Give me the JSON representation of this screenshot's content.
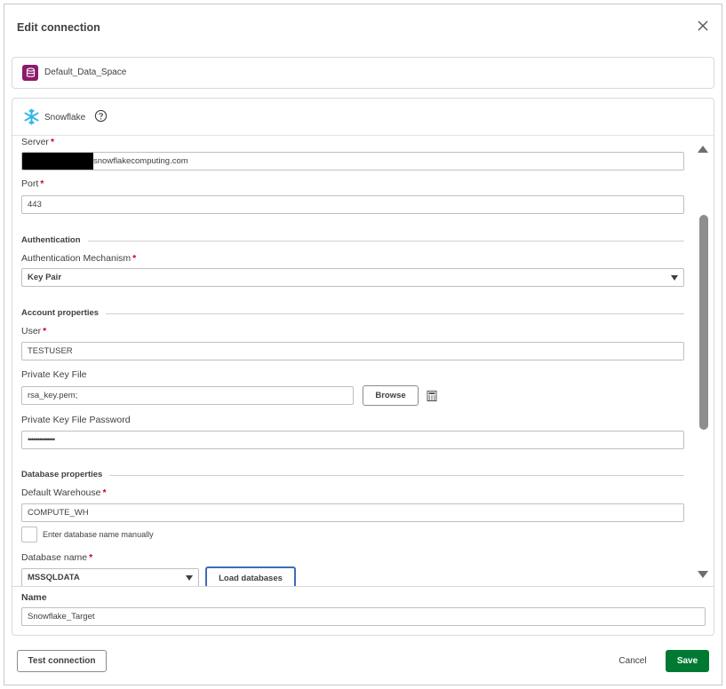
{
  "dialog": {
    "title": "Edit connection"
  },
  "space": {
    "name": "Default_Data_Space"
  },
  "connector": {
    "name": "Snowflake"
  },
  "fields": {
    "server": {
      "label": "Server",
      "value": "snowflakecomputing.com"
    },
    "port": {
      "label": "Port",
      "value": "443"
    },
    "auth_mechanism": {
      "label": "Authentication Mechanism",
      "value": "Key Pair"
    },
    "user": {
      "label": "User",
      "value": "TESTUSER"
    },
    "private_key_file": {
      "label": "Private Key File",
      "value": "rsa_key.pem;"
    },
    "private_key_password": {
      "label": "Private Key File Password",
      "value": "••••••••••••••"
    },
    "default_warehouse": {
      "label": "Default Warehouse",
      "value": "COMPUTE_WH"
    },
    "manual_db": {
      "label": "Enter database name manually"
    },
    "database_name": {
      "label": "Database name",
      "value": "MSSQLDATA"
    },
    "name": {
      "label": "Name",
      "value": "Snowflake_Target"
    }
  },
  "required_marker": "*",
  "sections": {
    "authentication": "Authentication",
    "account": "Account properties",
    "database": "Database properties"
  },
  "buttons": {
    "browse": "Browse",
    "load_databases": "Load databases",
    "test_connection": "Test connection",
    "cancel": "Cancel",
    "save": "Save"
  },
  "colors": {
    "space_icon": "#8b1b6b",
    "snowflake": "#29b5e8",
    "required": "#d0021b",
    "save": "#007a33",
    "load_border": "#3b6fb6"
  }
}
